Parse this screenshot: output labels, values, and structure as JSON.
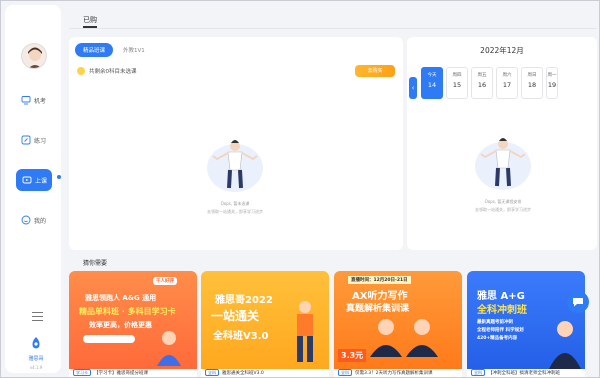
{
  "sidebar": {
    "items": [
      {
        "label": "机考"
      },
      {
        "label": "练习"
      },
      {
        "label": "上课"
      },
      {
        "label": "我的"
      }
    ],
    "brand_name": "雅思哥",
    "version": "v4.1.9"
  },
  "header": {
    "title": "已购"
  },
  "left_card": {
    "tabs": [
      "精品班课",
      "外教1V1"
    ],
    "unselected_text": "共剩余0科目未选课",
    "select_button": "去购买",
    "empty_caption": "Oops, 暂未选课",
    "empty_sub": "去领取一站通关，即享学习进步"
  },
  "right_card": {
    "month": "2022年12月",
    "days": [
      {
        "weekday": "今天",
        "date": "14"
      },
      {
        "weekday": "周四",
        "date": "15"
      },
      {
        "weekday": "周五",
        "date": "16"
      },
      {
        "weekday": "周六",
        "date": "17"
      },
      {
        "weekday": "周日",
        "date": "18"
      },
      {
        "weekday": "周一",
        "date": "19"
      }
    ],
    "empty_caption": "Oops, 暂无课程安排",
    "empty_sub": "去领取一站通关，即享学习进步"
  },
  "recommendations": {
    "title": "猜你需要",
    "courses": [
      {
        "tag": "学习卡",
        "label": "【学习卡】雅思哥提分班课",
        "banner_lines": [
          "雅思领跑人 A&G 通用",
          "精品单科班 · 多科目学习卡",
          "效率更高，价格更惠"
        ],
        "badge": "千人好评",
        "color": "#ff7a3d"
      },
      {
        "tag": "全科",
        "label": "雅思通关全科班V3.0",
        "banner_lines": [
          "雅思哥2022",
          "一站通关",
          "全科班V3.0"
        ],
        "badge": "",
        "color": "#ffb22a"
      },
      {
        "tag": "全科",
        "label": "仅需3.3！2天听力写作真题解析集训课",
        "banner_lines": [
          "直播时间：12月20日-21日",
          "AX听力写作",
          "真题解析集训课",
          "3.3元"
        ],
        "badge": "",
        "color": "#ff8a2a"
      },
      {
        "tag": "全科",
        "label": "【冲刺全科班】搞清老师全科冲刺班",
        "banner_lines": [
          "雅思 A+G",
          "全科冲刺班",
          "最新真题考前冲刺",
          "全程老师陪伴 科学规划",
          "420+精品备考内容"
        ],
        "badge": "",
        "color": "#2f6ff0"
      }
    ]
  }
}
